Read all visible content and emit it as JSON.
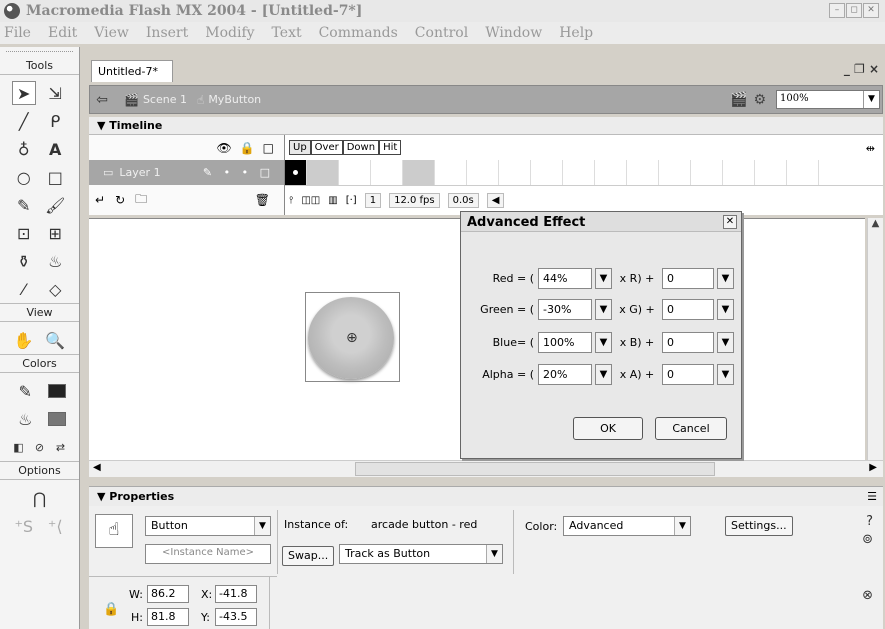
{
  "window": {
    "title": "Macromedia Flash MX 2004 - [Untitled-7*]",
    "controls": [
      "–",
      "◻",
      "✕"
    ]
  },
  "menu": [
    "File",
    "Edit",
    "View",
    "Insert",
    "Modify",
    "Text",
    "Commands",
    "Control",
    "Window",
    "Help"
  ],
  "toolbox": {
    "tools_label": "Tools",
    "view_label": "View",
    "colors_label": "Colors",
    "options_label": "Options"
  },
  "document": {
    "tab": "Untitled-7*",
    "tab_controls": "_ ❐ ×",
    "scene": "Scene 1",
    "symbol": "MyButton",
    "zoom": "100%"
  },
  "timeline": {
    "header": "Timeline",
    "frame_labels": [
      "Up",
      "Over",
      "Down",
      "Hit"
    ],
    "layer_name": "Layer 1",
    "current_frame": "1",
    "fps": "12.0 fps",
    "time": "0.0s"
  },
  "dialog": {
    "title": "Advanced Effect",
    "rows": [
      {
        "label": "Red = (",
        "percent": "44%",
        "op": "x R) +",
        "offset": "0"
      },
      {
        "label": "Green = (",
        "percent": "-30%",
        "op": "x G) +",
        "offset": "0"
      },
      {
        "label": "Blue= (",
        "percent": "100%",
        "op": "x B) +",
        "offset": "0"
      },
      {
        "label": "Alpha = (",
        "percent": "20%",
        "op": "x A) +",
        "offset": "0"
      }
    ],
    "ok_label": "OK",
    "cancel_label": "Cancel"
  },
  "properties": {
    "header": "Properties",
    "symbol_type": "Button",
    "instance_name_placeholder": "<Instance Name>",
    "instance_of_label": "Instance of:",
    "instance_of_value": "arcade button - red",
    "swap_label": "Swap...",
    "track_option": "Track as Button",
    "color_label": "Color:",
    "color_value": "Advanced",
    "settings_label": "Settings...",
    "w_label": "W:",
    "w_value": "86.2",
    "h_label": "H:",
    "h_value": "81.8",
    "x_label": "X:",
    "x_value": "-41.8",
    "y_label": "Y:",
    "y_value": "-43.5"
  }
}
